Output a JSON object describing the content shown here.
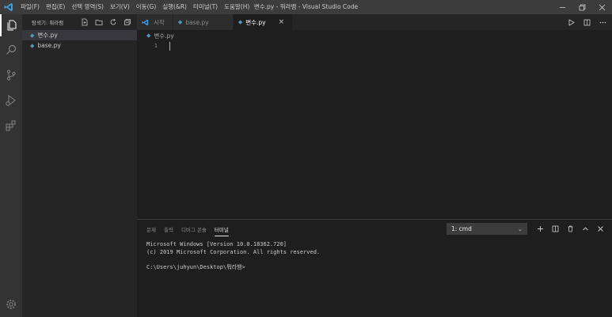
{
  "titlebar": {
    "title": "변수.py - 뭐라뱀 - Visual Studio Code",
    "menu": [
      "파일(F)",
      "편집(E)",
      "선택 영역(S)",
      "보기(V)",
      "이동(G)",
      "실행(&R)",
      "터미널(T)",
      "도움말(H)"
    ],
    "controls": [
      "minimize",
      "restore",
      "close"
    ]
  },
  "activity_bar": {
    "items": [
      "explorer-icon",
      "search-icon",
      "source-control-icon",
      "run-debug-icon",
      "extensions-icon"
    ],
    "bottom": "gear-icon"
  },
  "sidebar": {
    "header": "탐색기: 뭐라뱀",
    "files": [
      {
        "name": "변수.py",
        "selected": true
      },
      {
        "name": "base.py",
        "selected": false
      }
    ]
  },
  "tabs": [
    {
      "label": "시작",
      "icon": "vscode-icon",
      "active": false
    },
    {
      "label": "base.py",
      "icon": "python-icon",
      "active": false
    },
    {
      "label": "변수.py",
      "icon": "python-icon",
      "active": true,
      "close": "×"
    }
  ],
  "editor": {
    "breadcrumb": "변수.py",
    "line_number": "1"
  },
  "panel": {
    "tabs": [
      "문제",
      "출력",
      "디버그 콘솔",
      "터미널"
    ],
    "active_tab": "터미널",
    "terminal_select": "1: cmd",
    "terminal_lines": [
      "Microsoft Windows [Version 10.0.18362.720]",
      "(c) 2019 Microsoft Corporation. All rights reserved.",
      "",
      "C:\\Users\\juhyun\\Desktop\\뭐라뱀>"
    ]
  },
  "colors": {
    "titlebar": "#3c3c3c",
    "activity_bar": "#333333",
    "sidebar": "#252526",
    "editor": "#1e1e1e",
    "accent": "#007acc",
    "python_icon": "#519aba"
  }
}
